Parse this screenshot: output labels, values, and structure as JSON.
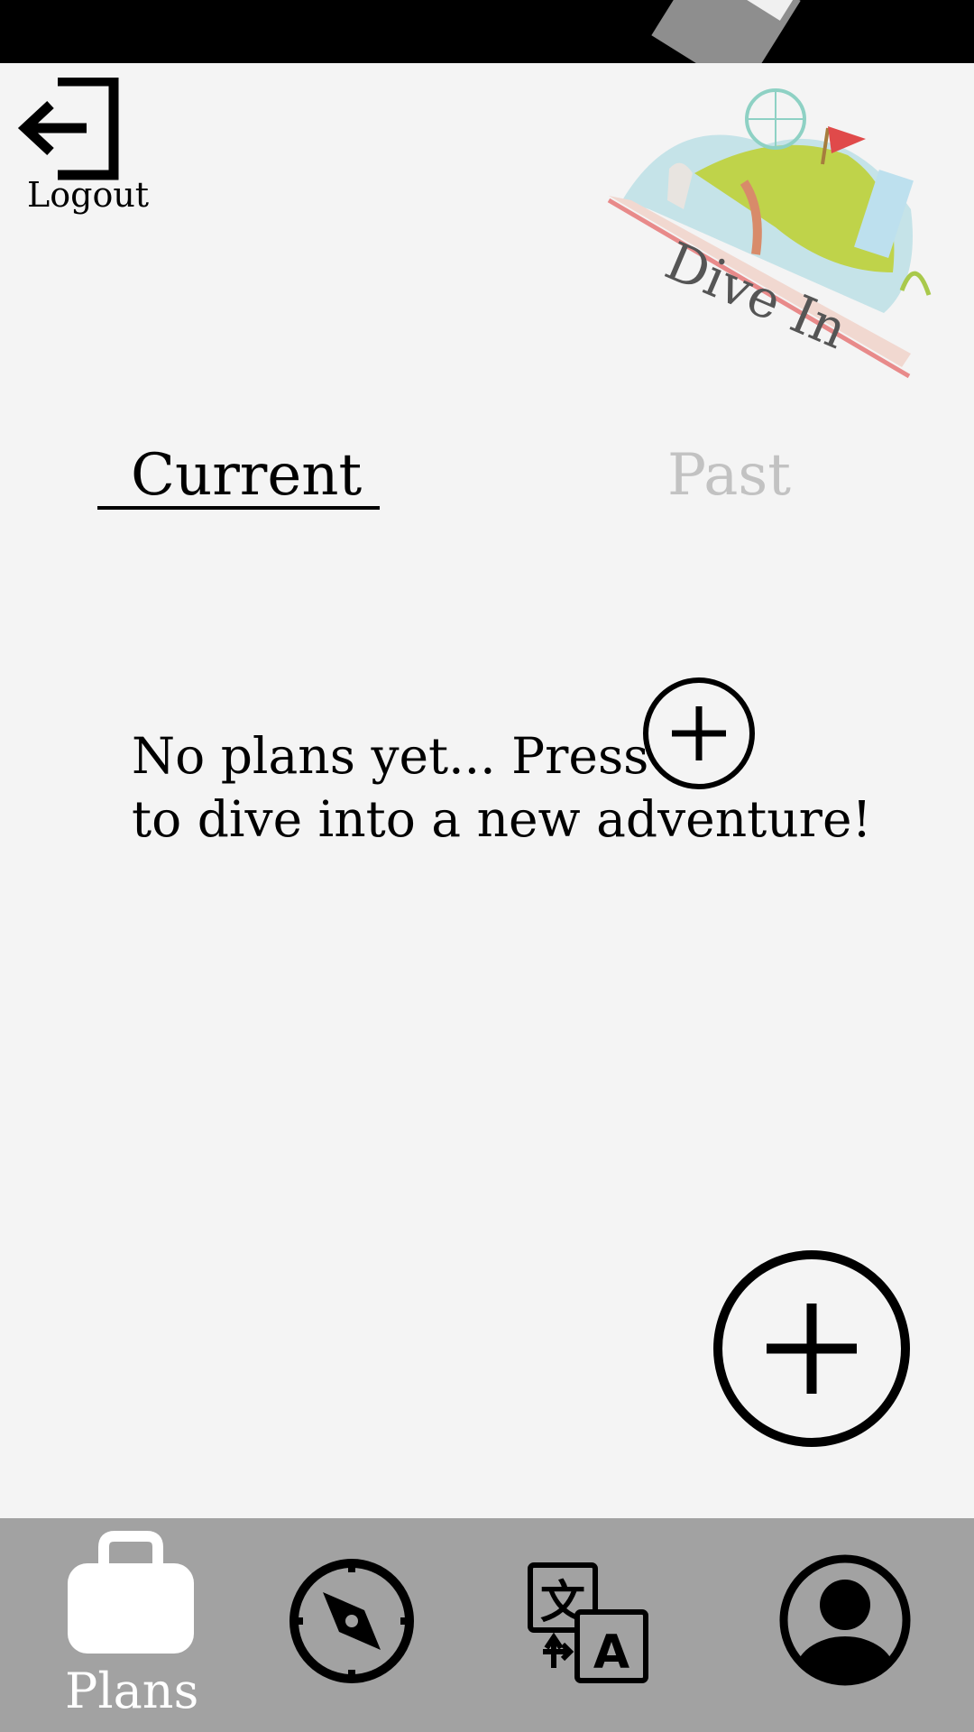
{
  "header": {
    "logout_label": "Logout",
    "logo_text": "Dive In"
  },
  "tabs": [
    {
      "label": "Current",
      "active": true
    },
    {
      "label": "Past",
      "active": false
    }
  ],
  "empty_state": {
    "line1": "No plans yet... Press",
    "line2": "to dive into a new adventure!"
  },
  "bottom_nav": {
    "items": [
      {
        "label": "Plans",
        "icon": "suitcase-icon",
        "active": true
      },
      {
        "label": "",
        "icon": "compass-icon",
        "active": false
      },
      {
        "label": "",
        "icon": "translate-icon",
        "active": false
      },
      {
        "label": "",
        "icon": "profile-icon",
        "active": false
      }
    ]
  },
  "colors": {
    "background": "#f4f4f4",
    "nav_background": "#a2a2a2",
    "inactive_tab": "#c2c2c2"
  }
}
